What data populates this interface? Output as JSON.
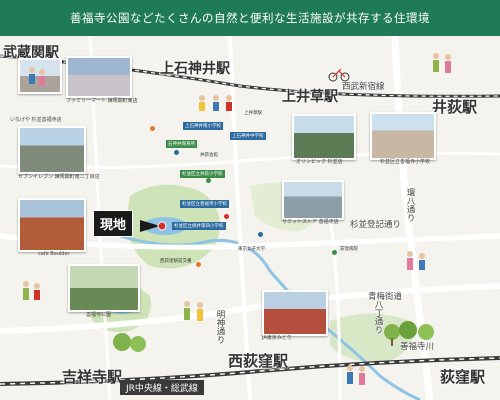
{
  "banner_title": "善福寺公園などたくさんの自然と便利な生活施設が共存する住環境",
  "here_label": "現地",
  "stations": {
    "musashiseki": "武蔵関駅",
    "kamishakujii": "上石神井駅",
    "kamiigusa": "上井草駅",
    "iogi": "井荻駅",
    "nishiogikubo": "西荻窪駅",
    "kichijoji": "吉祥寺駅",
    "ogikubo": "荻窪駅"
  },
  "roads": {
    "seibu_shinjuku": "西武新宿線",
    "kan8": "環八通り",
    "suginami_toki": "杉並登記通り",
    "oume_kaido": "青梅街道",
    "meiji_dori": "明神通り",
    "zenpukuji_river": "善福寺川",
    "hachi_dori": "八丁通り",
    "jr_chuo": "JR中央線・総武線"
  },
  "photo_captions": [
    "ファミリーマート 練馬関町東店",
    "セブンイレブン 練馬関町南二丁目店",
    "cafe Boulder",
    "善福寺公園",
    "オリンピック 杉並店",
    "杉並区立善福寺小学校",
    "サミットストア 善福寺店",
    "JA東京みどり",
    "いなげや 杉並善福寺店"
  ],
  "facility_labels": [
    "上石神井南小学校",
    "上石神井中学校",
    "石神井保育所",
    "上井草駅",
    "杉並区立井荻小学校",
    "杉並区立善福寺小学校",
    "杉並区立桃井第四小学校",
    "西荻窪駅前交番",
    "東京女子大学",
    "井荻会館",
    "荻窪病院"
  ],
  "colors": {
    "banner": "#1f7a57",
    "park": "#cfe3b8",
    "water": "#8fc3e4",
    "road": "#ffffff",
    "rail": "#3a3a3a",
    "here": "#1a1a1a",
    "map_bg": "#f4f3ee"
  }
}
